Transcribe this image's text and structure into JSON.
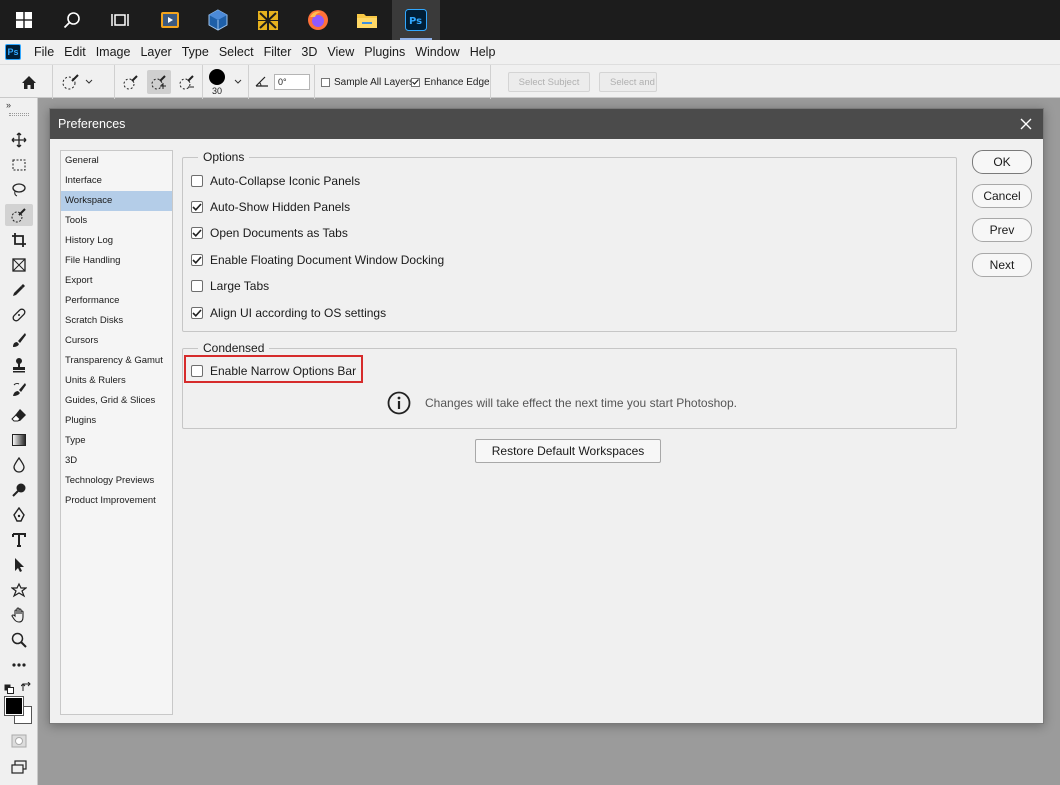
{
  "taskbar": {
    "icons": [
      "windows-start-icon",
      "search-icon",
      "task-view-icon",
      "media-player-icon",
      "virtualbox-icon",
      "app-icon",
      "firefox-icon",
      "file-explorer-icon",
      "photoshop-icon"
    ]
  },
  "app": {
    "logo": "Ps"
  },
  "menu": [
    "File",
    "Edit",
    "Image",
    "Layer",
    "Type",
    "Select",
    "Filter",
    "3D",
    "View",
    "Plugins",
    "Window",
    "Help"
  ],
  "options_bar": {
    "brush_size": "30",
    "angle_value": "0°",
    "sample_all_layers": "Sample All Layers",
    "enhance_edge": "Enhance Edge",
    "select_subject": "Select Subject",
    "select_and_mask": "Select and"
  },
  "dialog": {
    "title": "Preferences",
    "nav_items": [
      "General",
      "Interface",
      "Workspace",
      "Tools",
      "History Log",
      "File Handling",
      "Export",
      "Performance",
      "Scratch Disks",
      "Cursors",
      "Transparency & Gamut",
      "Units & Rulers",
      "Guides, Grid & Slices",
      "Plugins",
      "Type",
      "3D",
      "Technology Previews",
      "Product Improvement"
    ],
    "selected_nav": "Workspace",
    "options_legend": "Options",
    "options": [
      {
        "label": "Auto-Collapse Iconic Panels",
        "checked": false
      },
      {
        "label": "Auto-Show Hidden Panels",
        "checked": true
      },
      {
        "label": "Open Documents as Tabs",
        "checked": true
      },
      {
        "label": "Enable Floating Document Window Docking",
        "checked": true
      },
      {
        "label": "Large Tabs",
        "checked": false
      },
      {
        "label": "Align UI according to OS settings",
        "checked": true
      }
    ],
    "condensed_legend": "Condensed",
    "narrow_options_bar": {
      "label": "Enable Narrow Options Bar",
      "checked": false
    },
    "info_message": "Changes will take effect the next time you start Photoshop.",
    "restore_button": "Restore Default Workspaces",
    "buttons": {
      "ok": "OK",
      "cancel": "Cancel",
      "prev": "Prev",
      "next": "Next"
    }
  },
  "colors": {
    "highlight": "#d62b2b",
    "nav_selected": "#b4cde8",
    "title_bar": "#4b4b4b"
  }
}
